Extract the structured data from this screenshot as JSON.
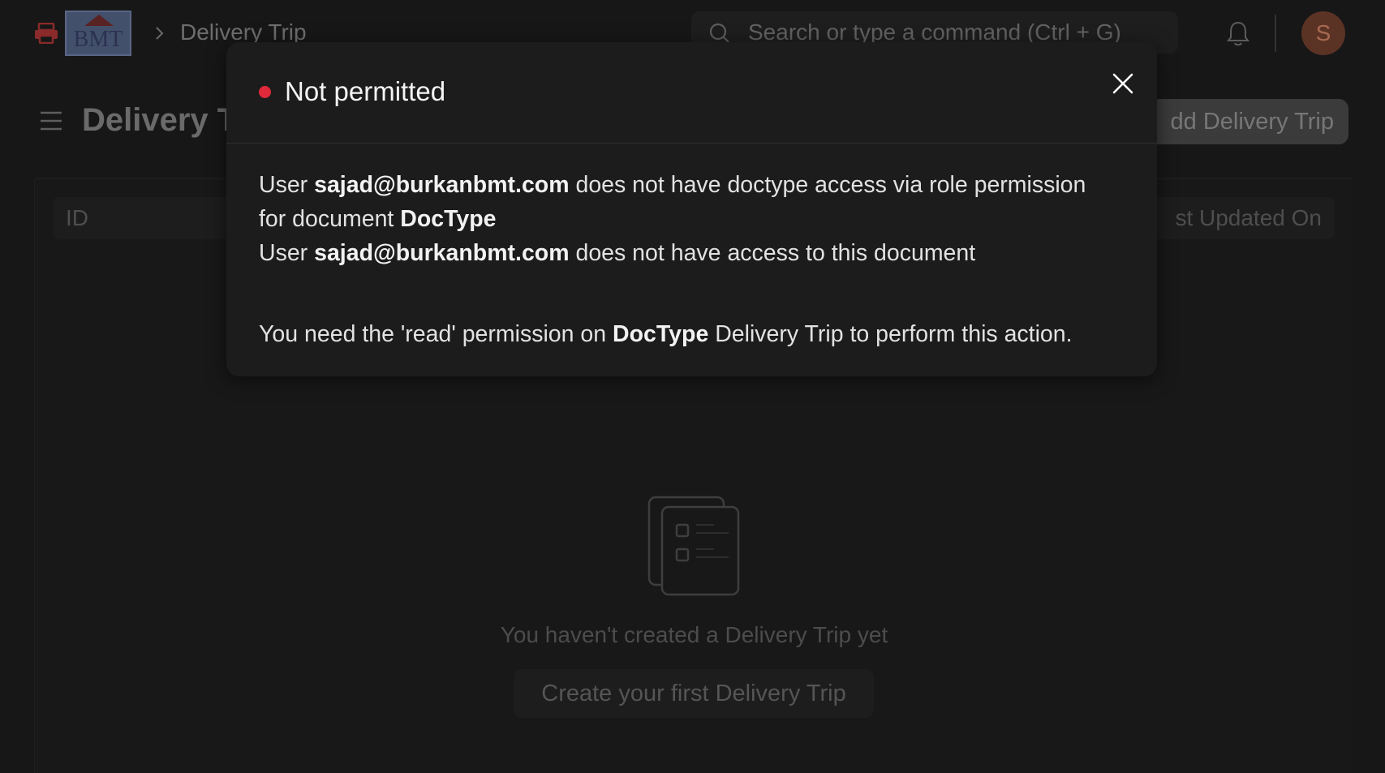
{
  "navbar": {
    "logo_text": "BMT",
    "breadcrumb": "Delivery Trip",
    "search_placeholder": "Search or type a command (Ctrl + G)",
    "avatar_initial": "S"
  },
  "page": {
    "title": "Delivery T",
    "add_button": "dd Delivery Trip"
  },
  "list": {
    "columns": {
      "id": "ID",
      "last_updated": "st Updated On"
    },
    "empty_message": "You haven't created a Delivery Trip yet",
    "create_button": "Create your first Delivery Trip"
  },
  "modal": {
    "title": "Not permitted",
    "status_color": "#e0293a",
    "line1_prefix": "User ",
    "line1_user": "sajad@burkanbmt.com",
    "line1_suffix": " does not have doctype access via role permission",
    "line2_prefix": "for document ",
    "line2_doctype": "DocType",
    "line3_prefix": "User ",
    "line3_user": "sajad@burkanbmt.com",
    "line3_suffix": " does not have access to this document",
    "line4_prefix": "You need the 'read' permission on ",
    "line4_doctype": "DocType",
    "line4_suffix": " Delivery Trip to perform this action."
  },
  "icons": {
    "app": "printer-icon",
    "breadcrumb_separator": "chevron-right-icon",
    "search": "search-icon",
    "notifications": "bell-icon",
    "sidebar_toggle": "hamburger-icon",
    "empty_state": "list-document-icon",
    "close": "close-icon"
  }
}
